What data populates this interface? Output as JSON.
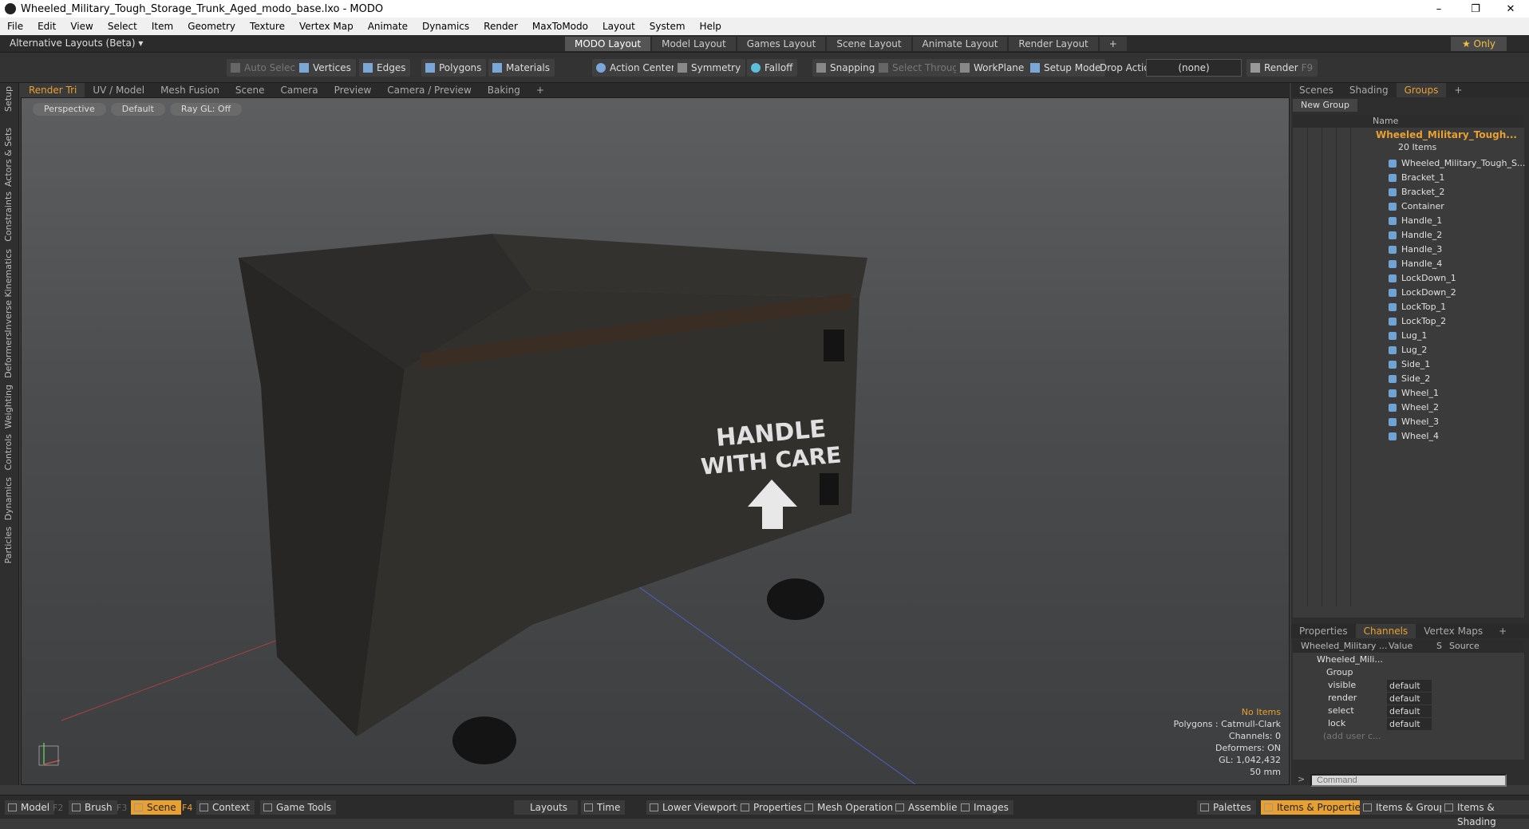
{
  "window": {
    "title": "Wheeled_Military_Tough_Storage_Trunk_Aged_modo_base.lxo - MODO",
    "minimize": "–",
    "restore": "❐",
    "close": "✕"
  },
  "menu": [
    "File",
    "Edit",
    "View",
    "Select",
    "Item",
    "Geometry",
    "Texture",
    "Vertex Map",
    "Animate",
    "Dynamics",
    "Render",
    "MaxToModo",
    "Layout",
    "System",
    "Help"
  ],
  "layoutbar": {
    "alt_layouts": "Alternative Layouts (Beta) ▾",
    "tabs": [
      "MODO Layout",
      "Model Layout",
      "Games Layout",
      "Scene Layout",
      "Animate Layout",
      "Render Layout"
    ],
    "add": "+",
    "only": "★ Only"
  },
  "toolbar": {
    "auto_select": "Auto Select",
    "vertices": "Vertices",
    "edges": "Edges",
    "polygons": "Polygons",
    "materials": "Materials",
    "action_center": "Action Center",
    "symmetry": "Symmetry",
    "falloff": "Falloff",
    "snapping": "Snapping",
    "select_through": "Select Through",
    "workplane": "WorkPlane",
    "setup_mode": "Setup Mode",
    "drop_action": "Drop Action",
    "drop_value": "(none)",
    "render": "Render",
    "render_key": "F9"
  },
  "left_tabs": [
    "Setup",
    "Actors & Sets",
    "Constraints",
    "Inverse Kinematics",
    "Deformers",
    "Weighting",
    "Controls",
    "Dynamics",
    "Particles"
  ],
  "viewport_tabs": [
    "Render Tri",
    "UV / Model",
    "Mesh Fusion",
    "Scene",
    "Camera",
    "Preview",
    "Camera / Preview",
    "Baking",
    "+"
  ],
  "viewport": {
    "view": "Perspective",
    "shading": "Default",
    "raygl": "Ray GL: Off",
    "crate_text_1": "HANDLE",
    "crate_text_2": "WITH CARE",
    "stats": {
      "items": "No Items",
      "polygons": "Polygons : Catmull-Clark",
      "channels": "Channels: 0",
      "deformers": "Deformers: ON",
      "gl": "GL: 1,042,432",
      "focal": "50 mm"
    }
  },
  "right_tabs": [
    "Scenes",
    "Shading",
    "Groups",
    "+"
  ],
  "groups": {
    "new_group": "New Group",
    "name_header": "Name",
    "root": "Wheeled_Military_Tough...",
    "root_count": "20 Items",
    "items": [
      "Wheeled_Military_Tough_S...",
      "Bracket_1",
      "Bracket_2",
      "Container",
      "Handle_1",
      "Handle_2",
      "Handle_3",
      "Handle_4",
      "LockDown_1",
      "LockDown_2",
      "LockTop_1",
      "LockTop_2",
      "Lug_1",
      "Lug_2",
      "Side_1",
      "Side_2",
      "Wheel_1",
      "Wheel_2",
      "Wheel_3",
      "Wheel_4"
    ]
  },
  "props_tabs": [
    "Properties",
    "Channels",
    "Vertex Maps",
    "+"
  ],
  "channels": {
    "col_name": "Wheeled_Military ...",
    "col_value": "Value",
    "col_s": "S",
    "col_source": "Source",
    "item": "Wheeled_Mili...",
    "group": "Group",
    "rows": [
      {
        "name": "visible",
        "value": "default"
      },
      {
        "name": "render",
        "value": "default"
      },
      {
        "name": "select",
        "value": "default"
      },
      {
        "name": "lock",
        "value": "default"
      }
    ],
    "add_user": "(add user c..."
  },
  "command": {
    "prompt": ">",
    "placeholder": "Command"
  },
  "statusbar": {
    "model": "Model",
    "model_key": "F2",
    "brush": "Brush",
    "brush_key": "F3",
    "scene": "Scene",
    "scene_key": "F4",
    "context": "Context",
    "game_tools": "Game Tools",
    "layouts": "Layouts",
    "time": "Time",
    "lower_viewports": "Lower Viewports",
    "properties": "Properties",
    "mesh_operations": "Mesh Operations",
    "assemblies": "Assemblies",
    "images": "Images",
    "palettes": "Palettes",
    "items_properties": "Items & Properties",
    "items_groups": "Items & Groups",
    "items_shading": "Items & Shading"
  },
  "colors": {
    "accent": "#e8a030",
    "mesh_icon": "#6fa3d4"
  }
}
